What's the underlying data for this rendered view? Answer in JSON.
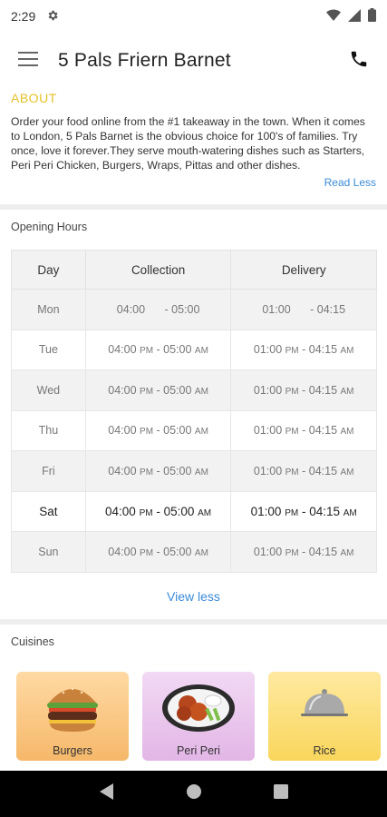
{
  "status": {
    "time": "2:29"
  },
  "header": {
    "title": "5 Pals Friern Barnet"
  },
  "about": {
    "heading": "ABOUT",
    "description": "Order your food online from the #1 takeaway in the town. When it comes to London, 5 Pals Barnet is the obvious choice for 100's of families. Try once, love it forever.They serve mouth-watering dishes such as Starters, Peri Peri Chicken, Burgers, Wraps, Pittas and other dishes.",
    "read_less": "Read Less"
  },
  "hours": {
    "title": "Opening Hours",
    "columns": [
      "Day",
      "Collection",
      "Delivery"
    ],
    "rows": [
      {
        "day": "Mon",
        "col_from": "04:00",
        "col_from_ampm": "",
        "col_to": "05:00",
        "col_to_ampm": "",
        "del_from": "01:00",
        "del_from_ampm": "",
        "del_to": "04:15",
        "del_to_ampm": ""
      },
      {
        "day": "Tue",
        "col_from": "04:00",
        "col_from_ampm": "PM",
        "col_to": "05:00",
        "col_to_ampm": "AM",
        "del_from": "01:00",
        "del_from_ampm": "PM",
        "del_to": "04:15",
        "del_to_ampm": "AM"
      },
      {
        "day": "Wed",
        "col_from": "04:00",
        "col_from_ampm": "PM",
        "col_to": "05:00",
        "col_to_ampm": "AM",
        "del_from": "01:00",
        "del_from_ampm": "PM",
        "del_to": "04:15",
        "del_to_ampm": "AM"
      },
      {
        "day": "Thu",
        "col_from": "04:00",
        "col_from_ampm": "PM",
        "col_to": "05:00",
        "col_to_ampm": "AM",
        "del_from": "01:00",
        "del_from_ampm": "PM",
        "del_to": "04:15",
        "del_to_ampm": "AM"
      },
      {
        "day": "Fri",
        "col_from": "04:00",
        "col_from_ampm": "PM",
        "col_to": "05:00",
        "col_to_ampm": "AM",
        "del_from": "01:00",
        "del_from_ampm": "PM",
        "del_to": "04:15",
        "del_to_ampm": "AM"
      },
      {
        "day": "Sat",
        "col_from": "04:00",
        "col_from_ampm": "PM",
        "col_to": "05:00",
        "col_to_ampm": "AM",
        "del_from": "01:00",
        "del_from_ampm": "PM",
        "del_to": "04:15",
        "del_to_ampm": "AM"
      },
      {
        "day": "Sun",
        "col_from": "04:00",
        "col_from_ampm": "PM",
        "col_to": "05:00",
        "col_to_ampm": "AM",
        "del_from": "01:00",
        "del_from_ampm": "PM",
        "del_to": "04:15",
        "del_to_ampm": "AM"
      }
    ],
    "view_less": "View less"
  },
  "cuisines": {
    "title": "Cuisines",
    "items": [
      {
        "label": "Burgers",
        "icon": "burger-icon"
      },
      {
        "label": "Peri Peri",
        "icon": "chicken-wings-icon"
      },
      {
        "label": "Rice",
        "icon": "cloche-icon"
      }
    ]
  },
  "colors": {
    "accent_yellow": "#e6c229",
    "link_blue": "#3a8bd8"
  }
}
